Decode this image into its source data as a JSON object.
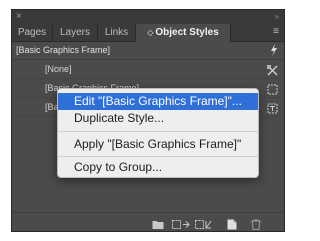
{
  "window": {
    "close_glyph": "×",
    "collapse_glyph": "››"
  },
  "tabs": [
    {
      "label": "Pages",
      "active": false
    },
    {
      "label": "Layers",
      "active": false
    },
    {
      "label": "Links",
      "active": false
    },
    {
      "label": " Object Styles",
      "active": true
    }
  ],
  "active_tab_prefix_glyph": "◇",
  "panel_menu_glyph": "≡",
  "header": {
    "current_style": "[Basic Graphics Frame]"
  },
  "styles": [
    {
      "label": "[None]",
      "icon": "clear-override-icon"
    },
    {
      "label": "[Basic Graphics Frame]",
      "icon": "graphics-frame-icon"
    },
    {
      "label": "[Ba",
      "icon": "text-frame-icon"
    }
  ],
  "context_menu": {
    "items": [
      {
        "label": "Edit \"[Basic Graphics Frame]\"...",
        "highlighted": true
      },
      {
        "label": "Duplicate Style...",
        "highlighted": false
      },
      {
        "label": "Apply \"[Basic Graphics Frame]\"",
        "highlighted": false
      },
      {
        "label": "Copy to Group...",
        "highlighted": false
      }
    ]
  },
  "colors": {
    "panel_bg": "#4b4b4b",
    "tab_bar_bg": "#3a3a3a",
    "menu_highlight": "#2f6fd8",
    "menu_bg": "#eeeeee"
  }
}
